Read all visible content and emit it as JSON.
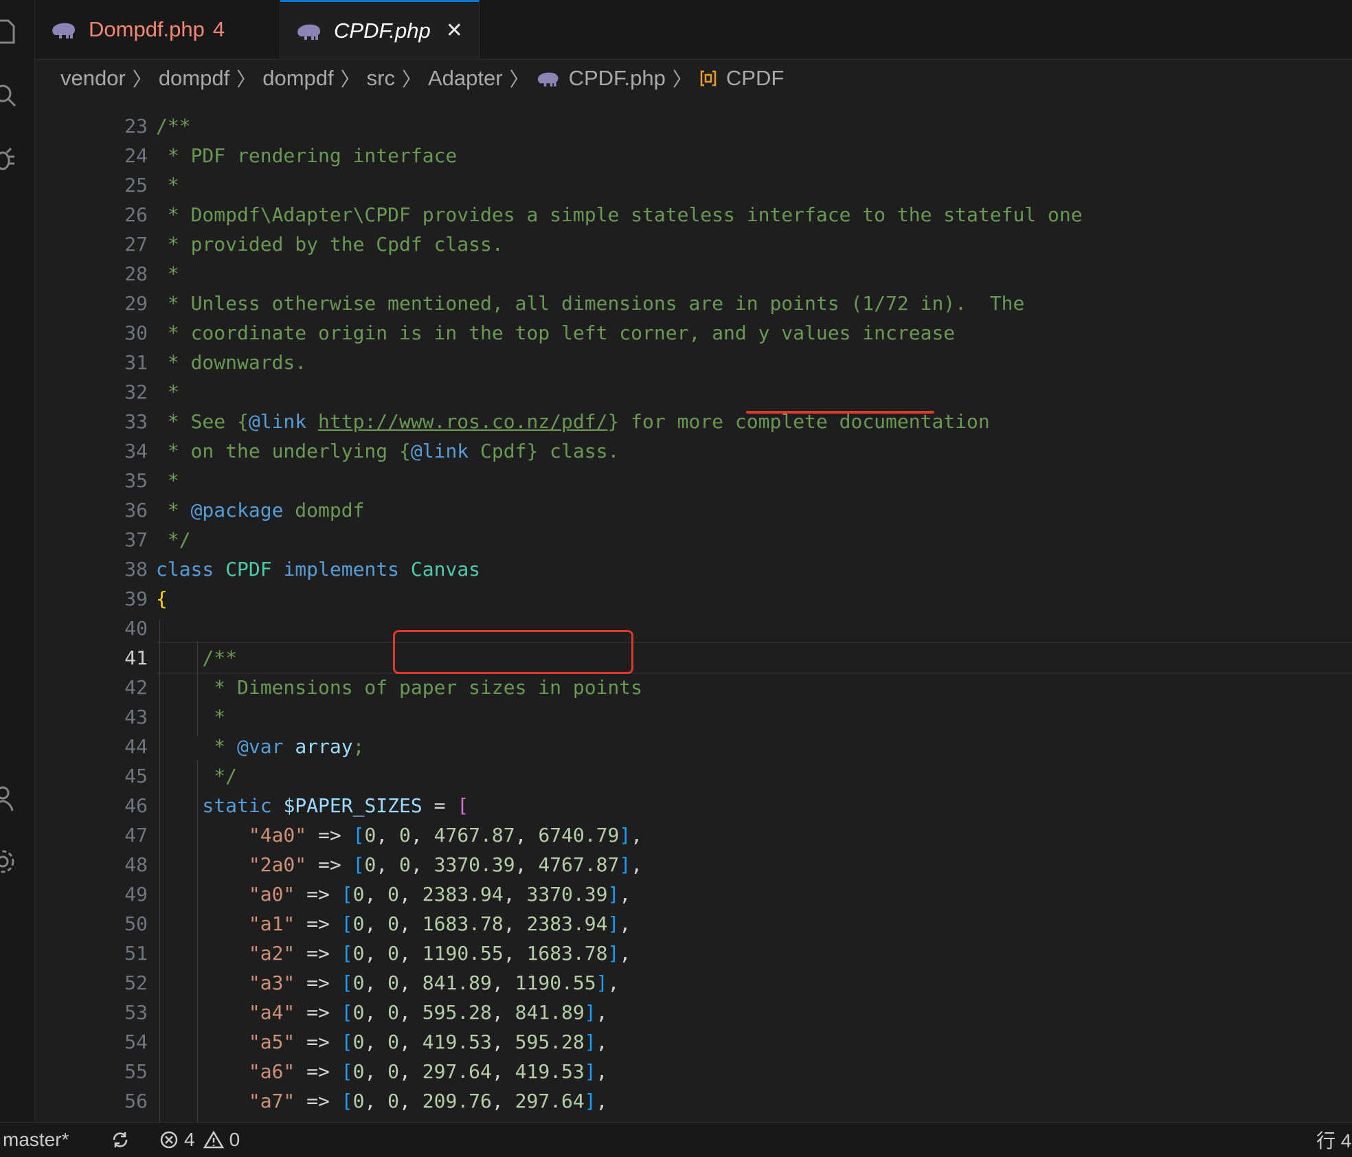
{
  "tabs": [
    {
      "label": "Dompdf.php",
      "badge": "4",
      "icon": "php-elephant-icon"
    },
    {
      "label": "CPDF.php",
      "close": "✕",
      "icon": "php-elephant-icon"
    }
  ],
  "breadcrumb": [
    "vendor",
    "dompdf",
    "dompdf",
    "src",
    "Adapter",
    "CPDF.php",
    "CPDF"
  ],
  "code_lines": [
    {
      "n": "23",
      "segments": [
        [
          "c-comment",
          "/**"
        ]
      ]
    },
    {
      "n": "24",
      "segments": [
        [
          "c-comment",
          " * PDF rendering interface"
        ]
      ]
    },
    {
      "n": "25",
      "segments": [
        [
          "c-comment",
          " *"
        ]
      ]
    },
    {
      "n": "26",
      "segments": [
        [
          "c-comment",
          " * Dompdf\\Adapter\\CPDF provides a simple stateless interface to the stateful one"
        ]
      ]
    },
    {
      "n": "27",
      "segments": [
        [
          "c-comment",
          " * provided by the Cpdf class."
        ]
      ]
    },
    {
      "n": "28",
      "segments": [
        [
          "c-comment",
          " *"
        ]
      ]
    },
    {
      "n": "29",
      "segments": [
        [
          "c-comment",
          " * Unless otherwise mentioned, all dimensions are in points (1/72 in).  The"
        ]
      ]
    },
    {
      "n": "30",
      "segments": [
        [
          "c-comment",
          " * coordinate origin is in the top left corner, and y values increase"
        ]
      ]
    },
    {
      "n": "31",
      "segments": [
        [
          "c-comment",
          " * downwards."
        ]
      ]
    },
    {
      "n": "32",
      "segments": [
        [
          "c-comment",
          " *"
        ]
      ]
    },
    {
      "n": "33",
      "segments": [
        [
          "c-comment",
          " * See {"
        ],
        [
          "c-tag",
          "@link"
        ],
        [
          "c-comment",
          " "
        ],
        [
          "c-link",
          "http://www.ros.co.nz/pdf/"
        ],
        [
          "c-comment",
          "} for more complete documentation"
        ]
      ]
    },
    {
      "n": "34",
      "segments": [
        [
          "c-comment",
          " * on the underlying {"
        ],
        [
          "c-tag",
          "@link"
        ],
        [
          "c-comment",
          " Cpdf} class."
        ]
      ]
    },
    {
      "n": "35",
      "segments": [
        [
          "c-comment",
          " *"
        ]
      ]
    },
    {
      "n": "36",
      "segments": [
        [
          "c-comment",
          " * "
        ],
        [
          "c-tag",
          "@package"
        ],
        [
          "c-comment",
          " dompdf"
        ]
      ]
    },
    {
      "n": "37",
      "segments": [
        [
          "c-comment",
          " */"
        ]
      ]
    },
    {
      "n": "38",
      "segments": [
        [
          "c-kw",
          "class"
        ],
        [
          "c-op",
          " "
        ],
        [
          "c-cls",
          "CPDF"
        ],
        [
          "c-op",
          " "
        ],
        [
          "c-kw",
          "implements"
        ],
        [
          "c-op",
          " "
        ],
        [
          "c-cls",
          "Canvas"
        ]
      ]
    },
    {
      "n": "39",
      "segments": [
        [
          "c-brace",
          "{"
        ]
      ]
    },
    {
      "n": "40",
      "segments": [
        [
          "c-op",
          ""
        ]
      ]
    },
    {
      "n": "41",
      "segments": [
        [
          "c-comment",
          "    /**"
        ]
      ]
    },
    {
      "n": "42",
      "segments": [
        [
          "c-comment",
          "     * Dimensions of paper sizes in points"
        ]
      ]
    },
    {
      "n": "43",
      "segments": [
        [
          "c-comment",
          "     *"
        ]
      ]
    },
    {
      "n": "44",
      "segments": [
        [
          "c-comment",
          "     * "
        ],
        [
          "c-tag",
          "@var"
        ],
        [
          "c-comment",
          " "
        ],
        [
          "c-var",
          "array"
        ],
        [
          "c-comment",
          ";"
        ]
      ]
    },
    {
      "n": "45",
      "segments": [
        [
          "c-comment",
          "     */"
        ]
      ]
    },
    {
      "n": "46",
      "segments": [
        [
          "c-kw",
          "    static"
        ],
        [
          "c-op",
          " "
        ],
        [
          "c-var",
          "$PAPER_SIZES"
        ],
        [
          "c-op",
          " = "
        ],
        [
          "c-brk",
          "["
        ]
      ]
    },
    {
      "n": "47",
      "segments": [
        [
          "c-str",
          "        \"4a0\""
        ],
        [
          "c-op",
          " => "
        ],
        [
          "c-brk2",
          "["
        ],
        [
          "c-num",
          "0"
        ],
        [
          "c-op",
          ", "
        ],
        [
          "c-num",
          "0"
        ],
        [
          "c-op",
          ", "
        ],
        [
          "c-num",
          "4767.87"
        ],
        [
          "c-op",
          ", "
        ],
        [
          "c-num",
          "6740.79"
        ],
        [
          "c-brk2",
          "]"
        ],
        [
          "c-op",
          ","
        ]
      ]
    },
    {
      "n": "48",
      "segments": [
        [
          "c-str",
          "        \"2a0\""
        ],
        [
          "c-op",
          " => "
        ],
        [
          "c-brk2",
          "["
        ],
        [
          "c-num",
          "0"
        ],
        [
          "c-op",
          ", "
        ],
        [
          "c-num",
          "0"
        ],
        [
          "c-op",
          ", "
        ],
        [
          "c-num",
          "3370.39"
        ],
        [
          "c-op",
          ", "
        ],
        [
          "c-num",
          "4767.87"
        ],
        [
          "c-brk2",
          "]"
        ],
        [
          "c-op",
          ","
        ]
      ]
    },
    {
      "n": "49",
      "segments": [
        [
          "c-str",
          "        \"a0\""
        ],
        [
          "c-op",
          " => "
        ],
        [
          "c-brk2",
          "["
        ],
        [
          "c-num",
          "0"
        ],
        [
          "c-op",
          ", "
        ],
        [
          "c-num",
          "0"
        ],
        [
          "c-op",
          ", "
        ],
        [
          "c-num",
          "2383.94"
        ],
        [
          "c-op",
          ", "
        ],
        [
          "c-num",
          "3370.39"
        ],
        [
          "c-brk2",
          "]"
        ],
        [
          "c-op",
          ","
        ]
      ]
    },
    {
      "n": "50",
      "segments": [
        [
          "c-str",
          "        \"a1\""
        ],
        [
          "c-op",
          " => "
        ],
        [
          "c-brk2",
          "["
        ],
        [
          "c-num",
          "0"
        ],
        [
          "c-op",
          ", "
        ],
        [
          "c-num",
          "0"
        ],
        [
          "c-op",
          ", "
        ],
        [
          "c-num",
          "1683.78"
        ],
        [
          "c-op",
          ", "
        ],
        [
          "c-num",
          "2383.94"
        ],
        [
          "c-brk2",
          "]"
        ],
        [
          "c-op",
          ","
        ]
      ]
    },
    {
      "n": "51",
      "segments": [
        [
          "c-str",
          "        \"a2\""
        ],
        [
          "c-op",
          " => "
        ],
        [
          "c-brk2",
          "["
        ],
        [
          "c-num",
          "0"
        ],
        [
          "c-op",
          ", "
        ],
        [
          "c-num",
          "0"
        ],
        [
          "c-op",
          ", "
        ],
        [
          "c-num",
          "1190.55"
        ],
        [
          "c-op",
          ", "
        ],
        [
          "c-num",
          "1683.78"
        ],
        [
          "c-brk2",
          "]"
        ],
        [
          "c-op",
          ","
        ]
      ]
    },
    {
      "n": "52",
      "segments": [
        [
          "c-str",
          "        \"a3\""
        ],
        [
          "c-op",
          " => "
        ],
        [
          "c-brk2",
          "["
        ],
        [
          "c-num",
          "0"
        ],
        [
          "c-op",
          ", "
        ],
        [
          "c-num",
          "0"
        ],
        [
          "c-op",
          ", "
        ],
        [
          "c-num",
          "841.89"
        ],
        [
          "c-op",
          ", "
        ],
        [
          "c-num",
          "1190.55"
        ],
        [
          "c-brk2",
          "]"
        ],
        [
          "c-op",
          ","
        ]
      ]
    },
    {
      "n": "53",
      "segments": [
        [
          "c-str",
          "        \"a4\""
        ],
        [
          "c-op",
          " => "
        ],
        [
          "c-brk2",
          "["
        ],
        [
          "c-num",
          "0"
        ],
        [
          "c-op",
          ", "
        ],
        [
          "c-num",
          "0"
        ],
        [
          "c-op",
          ", "
        ],
        [
          "c-num",
          "595.28"
        ],
        [
          "c-op",
          ", "
        ],
        [
          "c-num",
          "841.89"
        ],
        [
          "c-brk2",
          "]"
        ],
        [
          "c-op",
          ","
        ]
      ]
    },
    {
      "n": "54",
      "segments": [
        [
          "c-str",
          "        \"a5\""
        ],
        [
          "c-op",
          " => "
        ],
        [
          "c-brk2",
          "["
        ],
        [
          "c-num",
          "0"
        ],
        [
          "c-op",
          ", "
        ],
        [
          "c-num",
          "0"
        ],
        [
          "c-op",
          ", "
        ],
        [
          "c-num",
          "419.53"
        ],
        [
          "c-op",
          ", "
        ],
        [
          "c-num",
          "595.28"
        ],
        [
          "c-brk2",
          "]"
        ],
        [
          "c-op",
          ","
        ]
      ]
    },
    {
      "n": "55",
      "segments": [
        [
          "c-str",
          "        \"a6\""
        ],
        [
          "c-op",
          " => "
        ],
        [
          "c-brk2",
          "["
        ],
        [
          "c-num",
          "0"
        ],
        [
          "c-op",
          ", "
        ],
        [
          "c-num",
          "0"
        ],
        [
          "c-op",
          ", "
        ],
        [
          "c-num",
          "297.64"
        ],
        [
          "c-op",
          ", "
        ],
        [
          "c-num",
          "419.53"
        ],
        [
          "c-brk2",
          "]"
        ],
        [
          "c-op",
          ","
        ]
      ]
    },
    {
      "n": "56",
      "segments": [
        [
          "c-str",
          "        \"a7\""
        ],
        [
          "c-op",
          " => "
        ],
        [
          "c-brk2",
          "["
        ],
        [
          "c-num",
          "0"
        ],
        [
          "c-op",
          ", "
        ],
        [
          "c-num",
          "0"
        ],
        [
          "c-op",
          ", "
        ],
        [
          "c-num",
          "209.76"
        ],
        [
          "c-op",
          ", "
        ],
        [
          "c-num",
          "297.64"
        ],
        [
          "c-brk2",
          "]"
        ],
        [
          "c-op",
          ","
        ]
      ]
    }
  ],
  "active_line": "41",
  "statusbar": {
    "branch": "master*",
    "errors": "4",
    "warnings": "0",
    "position": "行 4"
  },
  "colors": {
    "annotation": "#e2382a",
    "accent": "#0078d4"
  }
}
